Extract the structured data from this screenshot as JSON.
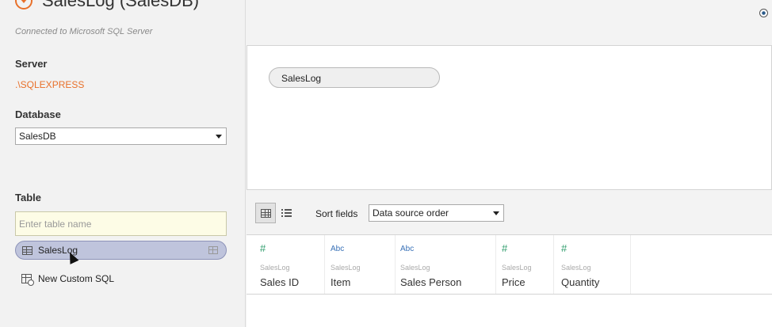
{
  "window": {
    "title": "SalesLog (SalesDB)",
    "connection_status": "Connected to Microsoft SQL Server"
  },
  "sidebar": {
    "server_label": "Server",
    "server_value": ".\\SQLEXPRESS",
    "database_label": "Database",
    "database_selected": "SalesDB",
    "table_label": "Table",
    "table_search_placeholder": "Enter table name",
    "tables": [
      {
        "label": "SalesLog"
      }
    ],
    "custom_sql_label": "New Custom SQL"
  },
  "canvas": {
    "tables": [
      {
        "label": "SalesLog"
      }
    ]
  },
  "toolbar": {
    "sort_label": "Sort fields",
    "sort_selected": "Data source order"
  },
  "grid": {
    "columns": [
      {
        "type": "#",
        "source": "SalesLog",
        "name": "Sales ID"
      },
      {
        "type": "Abc",
        "source": "SalesLog",
        "name": "Item"
      },
      {
        "type": "Abc",
        "source": "SalesLog",
        "name": "Sales Person"
      },
      {
        "type": "#",
        "source": "SalesLog",
        "name": "Price"
      },
      {
        "type": "#",
        "source": "SalesLog",
        "name": "Quantity"
      }
    ]
  },
  "colors": {
    "accent": "#e8702a",
    "numeric_type": "#2e9c6b",
    "string_type": "#3a72b8",
    "selected_table": "#bfc4dc"
  }
}
